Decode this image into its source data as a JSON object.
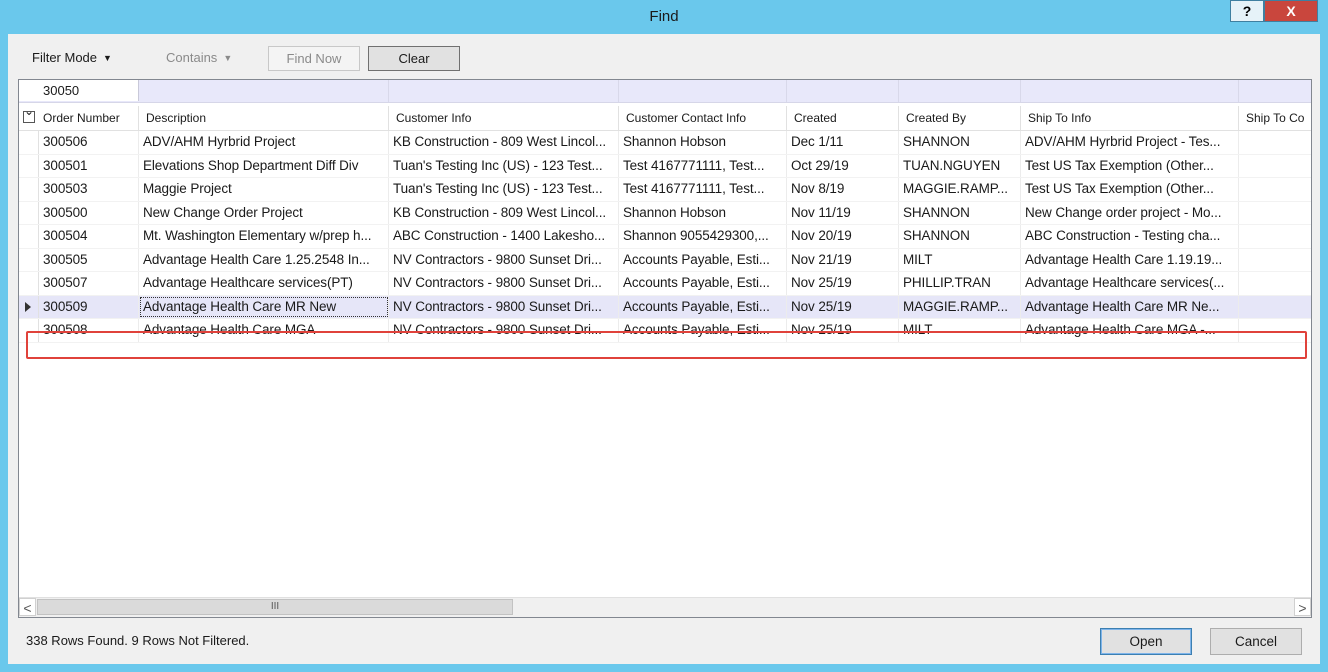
{
  "window": {
    "title": "Find",
    "help_label": "?",
    "close_label": "X"
  },
  "toolbar": {
    "filter_mode_label": "Filter Mode",
    "contains_label": "Contains",
    "find_now_label": "Find Now",
    "clear_label": "Clear"
  },
  "filter": {
    "value": "30050"
  },
  "columns": [
    "Order Number",
    "Description",
    "Customer Info",
    "Customer Contact Info",
    "Created",
    "Created By",
    "Ship To Info",
    "Ship To Co"
  ],
  "rows": [
    {
      "order": "300506",
      "desc": "ADV/AHM Hyrbrid Project",
      "cust": "KB Construction - 809 West Lincol...",
      "contact": "Shannon Hobson",
      "created": "Dec 1/11",
      "by": "SHANNON",
      "ship": "ADV/AHM Hyrbrid Project - Tes..."
    },
    {
      "order": "300501",
      "desc": "Elevations Shop Department Diff Div",
      "cust": "Tuan's Testing Inc (US) - 123 Test...",
      "contact": "Test 4167771111, Test...",
      "created": "Oct 29/19",
      "by": "TUAN.NGUYEN",
      "ship": "Test US Tax Exemption (Other..."
    },
    {
      "order": "300503",
      "desc": "Maggie Project",
      "cust": "Tuan's Testing Inc (US) - 123 Test...",
      "contact": "Test 4167771111, Test...",
      "created": "Nov 8/19",
      "by": "MAGGIE.RAMP...",
      "ship": "Test US Tax Exemption (Other..."
    },
    {
      "order": "300500",
      "desc": "New Change Order Project",
      "cust": "KB Construction - 809 West Lincol...",
      "contact": "Shannon Hobson",
      "created": "Nov 11/19",
      "by": "SHANNON",
      "ship": "New Change order project - Mo..."
    },
    {
      "order": "300504",
      "desc": "Mt. Washington Elementary w/prep h...",
      "cust": "ABC Construction - 1400 Lakesho...",
      "contact": "Shannon 9055429300,...",
      "created": "Nov 20/19",
      "by": "SHANNON",
      "ship": "ABC Construction - Testing cha..."
    },
    {
      "order": "300505",
      "desc": "Advantage Health Care 1.25.2548 In...",
      "cust": "NV Contractors - 9800 Sunset Dri...",
      "contact": "Accounts Payable, Esti...",
      "created": "Nov 21/19",
      "by": "MILT",
      "ship": "Advantage Health Care 1.19.19..."
    },
    {
      "order": "300507",
      "desc": "Advantage Healthcare services(PT)",
      "cust": "NV Contractors - 9800 Sunset Dri...",
      "contact": "Accounts Payable, Esti...",
      "created": "Nov 25/19",
      "by": "PHILLIP.TRAN",
      "ship": "Advantage Healthcare services(..."
    },
    {
      "order": "300509",
      "desc": "Advantage Health Care MR New",
      "cust": "NV Contractors - 9800 Sunset Dri...",
      "contact": "Accounts Payable, Esti...",
      "created": "Nov 25/19",
      "by": "MAGGIE.RAMP...",
      "ship": "Advantage Health Care MR Ne..."
    },
    {
      "order": "300508",
      "desc": "Advantage Health Care MGA",
      "cust": "NV Contractors - 9800 Sunset Dri...",
      "contact": "Accounts Payable, Esti...",
      "created": "Nov 25/19",
      "by": "MILT",
      "ship": "Advantage Health Care MGA -..."
    }
  ],
  "scrollbar": {
    "left_arrow": "<",
    "right_arrow": ">",
    "grip": "III"
  },
  "status": {
    "text": "338 Rows Found.  9 Rows Not Filtered."
  },
  "buttons": {
    "open_label": "Open",
    "cancel_label": "Cancel"
  }
}
